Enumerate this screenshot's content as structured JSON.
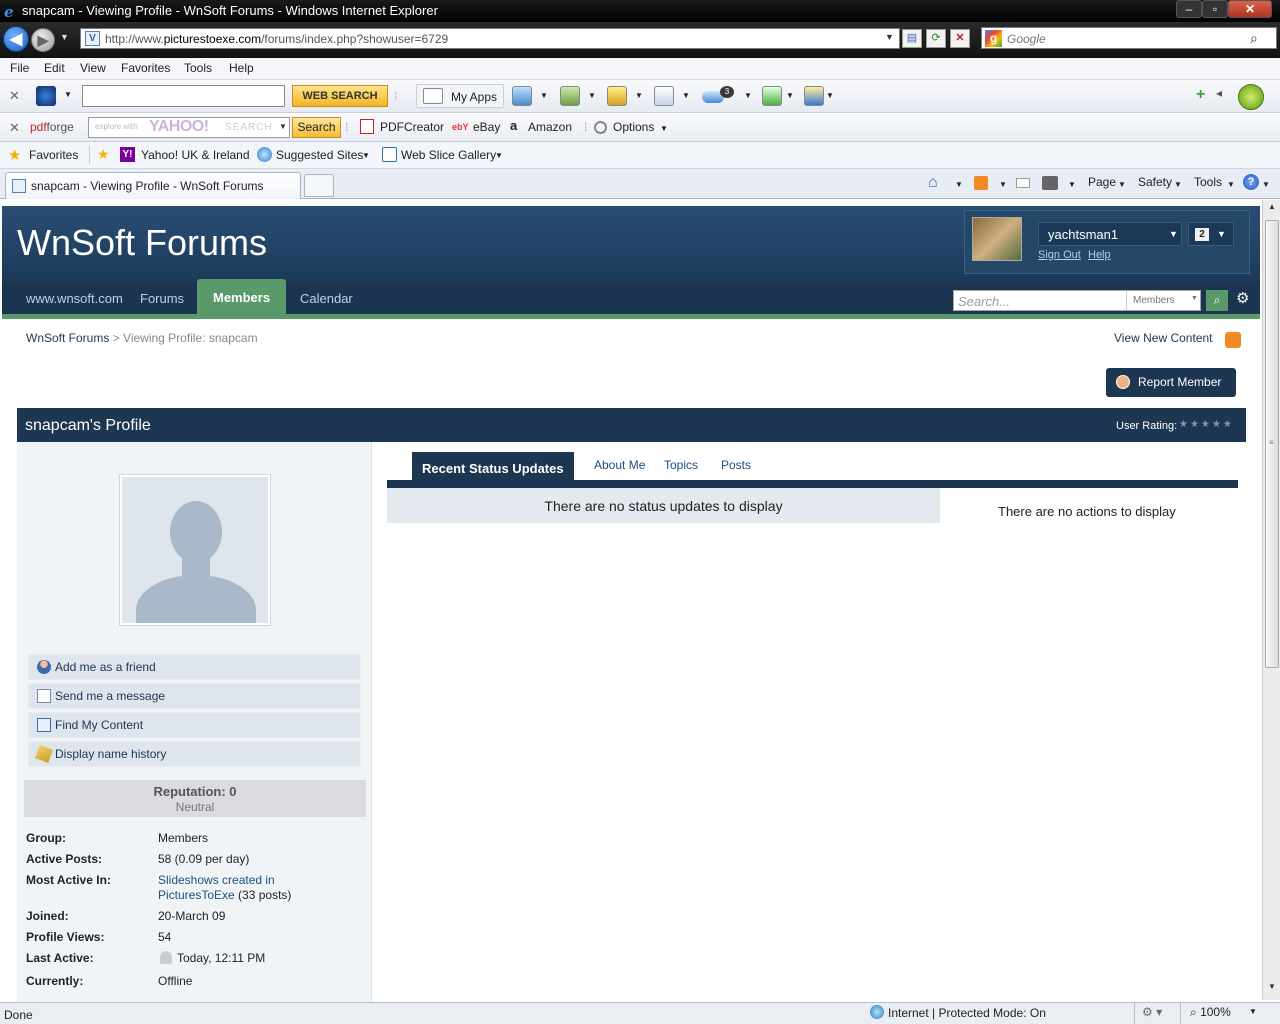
{
  "window": {
    "title": "snapcam - Viewing Profile - WnSoft Forums - Windows Internet Explorer",
    "icon": "ie-logo-icon"
  },
  "address": {
    "url_prefix": "http://www.",
    "url_domain": "picturestoexe.com",
    "url_path": "/forums/index.php?showuser=6729",
    "search_placeholder": "Google"
  },
  "menu": [
    "File",
    "Edit",
    "View",
    "Favorites",
    "Tools",
    "Help"
  ],
  "toolbar1": {
    "web_search": "WEB SEARCH",
    "my_apps": "My Apps",
    "weather_badge": "3"
  },
  "toolbar2": {
    "pdfforge": "pdf",
    "pdfforge_rest": "forge",
    "yahoo_placeholder": "explore with",
    "yahoo_brand": "YAHOO!",
    "yahoo_search_word": "SEARCH",
    "search_button": "Search",
    "pdfcreator": "PDFCreator",
    "ebay": "eBay",
    "ebay_logo": "ebY",
    "amazon": "Amazon",
    "amazon_logo": "a",
    "options": "Options"
  },
  "favorites": {
    "label": "Favorites",
    "items": [
      "Yahoo! UK & Ireland",
      "Suggested Sites",
      "Web Slice Gallery"
    ],
    "yahoo_icon": "Y!"
  },
  "tab": {
    "label": "snapcam - Viewing Profile - WnSoft Forums"
  },
  "commandbar": {
    "page": "Page",
    "safety": "Safety",
    "tools": "Tools",
    "help": "?"
  },
  "site": {
    "title": "WnSoft Forums",
    "user": {
      "name": "yachtsman1",
      "notifications": "2",
      "sign_out": "Sign Out",
      "help": "Help"
    },
    "nav": [
      "www.wnsoft.com",
      "Forums",
      "Members",
      "Calendar"
    ],
    "active_nav": "Members",
    "search": {
      "placeholder": "Search...",
      "scope": "Members"
    }
  },
  "breadcrumb": {
    "home": "WnSoft Forums",
    "current": "> Viewing Profile: snapcam"
  },
  "view_new_content": "View New Content",
  "report_member": "Report Member",
  "profile": {
    "title": "snapcam's Profile",
    "user_rating_label": "User Rating:",
    "rating_stars": 0,
    "rating_display": "★★★★★",
    "actions": [
      "Add me as a friend",
      "Send me a message",
      "Find My Content",
      "Display name history"
    ],
    "reputation_title": "Reputation: 0",
    "reputation_sub": "Neutral",
    "info": {
      "group_label": "Group:",
      "group": "Members",
      "active_posts_label": "Active Posts:",
      "active_posts": "58 (0.09 per day)",
      "most_active_label": "Most Active In:",
      "most_active_line1": "Slideshows created in",
      "most_active_line2_link": "PicturesToExe",
      "most_active_line2_rest": " (33 posts)",
      "joined_label": "Joined:",
      "joined": "20-March 09",
      "views_label": "Profile Views:",
      "views": "54",
      "last_active_label": "Last Active:",
      "last_active": "Today, 12:11 PM",
      "currently_label": "Currently:",
      "currently": "Offline"
    },
    "tabs": [
      "Recent Status Updates",
      "About Me",
      "Topics",
      "Posts"
    ],
    "no_status": "There are no status updates to display",
    "no_actions": "There are no actions to display"
  },
  "statusbar": {
    "done": "Done",
    "zone": "Internet | Protected Mode: On",
    "zoom": "100%"
  }
}
